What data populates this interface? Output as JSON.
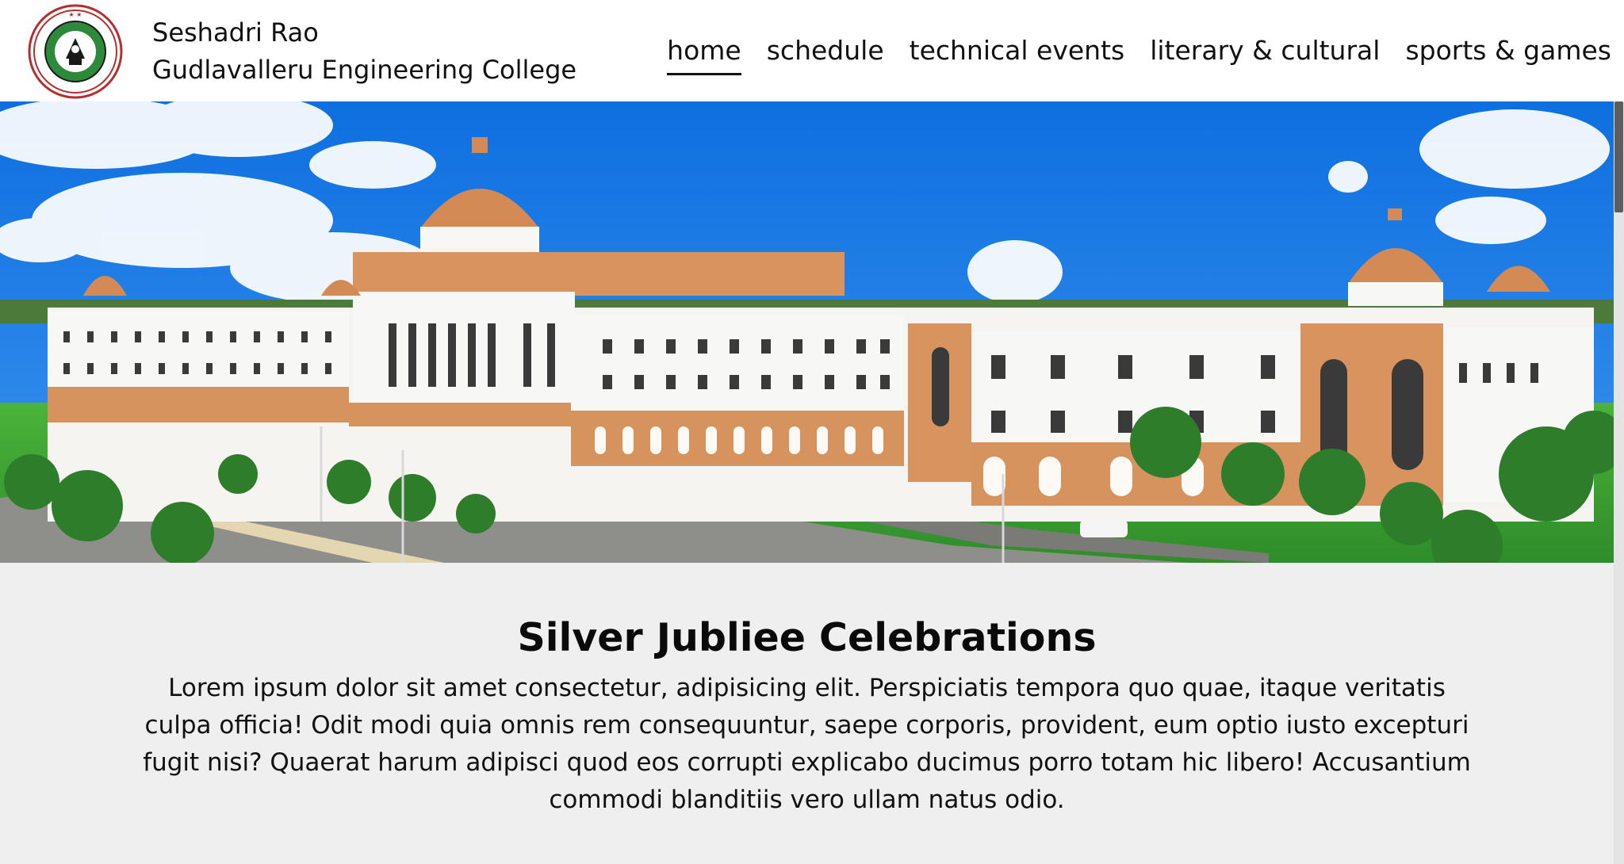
{
  "brand": {
    "line1": "Seshadri Rao",
    "line2": "Gudlavalleru Engineering College",
    "logo_icon": "college-seal-logo"
  },
  "nav": {
    "items": [
      {
        "label": "home",
        "active": true
      },
      {
        "label": "schedule",
        "active": false
      },
      {
        "label": "technical events",
        "active": false
      },
      {
        "label": "literary & cultural",
        "active": false
      },
      {
        "label": "sports & games",
        "active": false
      }
    ]
  },
  "hero": {
    "image": "college-campus-panorama",
    "colors": {
      "sky": "#1a7fe8",
      "building_white": "#f7f7f5",
      "building_accent": "#d9935e",
      "grass": "#3fa833"
    }
  },
  "section": {
    "title": "Silver Jubliee Celebrations",
    "body": "Lorem ipsum dolor sit amet consectetur, adipisicing elit. Perspiciatis tempora quo quae, itaque veritatis culpa officia! Odit modi quia omnis rem consequuntur, saepe corporis, provident, eum optio iusto excepturi fugit nisi? Quaerat harum adipisci quod eos corrupti explicabo ducimus porro totam hic libero! Accusantium commodi blanditiis vero ullam natus odio."
  }
}
